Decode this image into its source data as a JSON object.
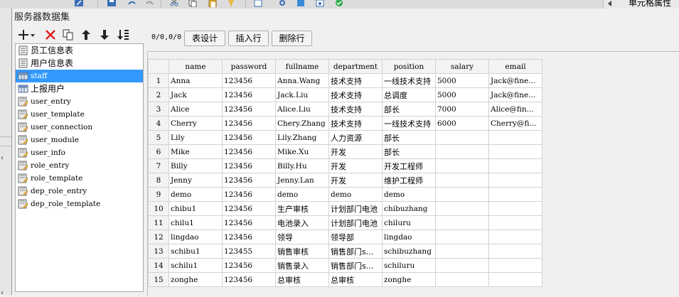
{
  "background": {
    "right_panel_label": "单元格属性"
  },
  "dialog": {
    "title": "服务器数据集"
  },
  "left_toolbar": {
    "add_icon": "plus-dropdown-icon",
    "delete_icon": "red-x-icon",
    "copy_icon": "copy-icon",
    "up_icon": "arrow-up-icon",
    "down_icon": "arrow-down-icon",
    "sort_icon": "sort-icon"
  },
  "tree": {
    "items": [
      {
        "label": "员工信息表",
        "icon": "table-doc-icon",
        "selected": false
      },
      {
        "label": "用户信息表",
        "icon": "table-doc-icon",
        "selected": false
      },
      {
        "label": "staff",
        "icon": "db-table-icon",
        "selected": true
      },
      {
        "label": "上报用户",
        "icon": "db-table-icon",
        "selected": false
      },
      {
        "label": "user_entry",
        "icon": "class-icon",
        "selected": false
      },
      {
        "label": "user_template",
        "icon": "class-icon",
        "selected": false
      },
      {
        "label": "user_connection",
        "icon": "class-icon",
        "selected": false
      },
      {
        "label": "user_module",
        "icon": "class-icon",
        "selected": false
      },
      {
        "label": "user_info",
        "icon": "class-icon",
        "selected": false
      },
      {
        "label": "role_entry",
        "icon": "class-icon",
        "selected": false
      },
      {
        "label": "role_template",
        "icon": "class-icon",
        "selected": false
      },
      {
        "label": "dep_role_entry",
        "icon": "class-icon",
        "selected": false
      },
      {
        "label": "dep_role_template",
        "icon": "class-icon",
        "selected": false
      }
    ]
  },
  "right_toolbar": {
    "coord": "0/0,0/0",
    "design_label": "表设计",
    "insert_label": "插入行",
    "delete_label": "删除行"
  },
  "grid": {
    "columns": [
      "name",
      "password",
      "fullname",
      "department",
      "position",
      "salary",
      "email"
    ],
    "rows": [
      [
        "1",
        "Anna",
        "123456",
        "Anna.Wang",
        "技术支持",
        "一线技术支持",
        "5000",
        "Jack@fine..."
      ],
      [
        "2",
        "Jack",
        "123456",
        "Jack.Liu",
        "技术支持",
        "总调度",
        "5000",
        "Jack@fine..."
      ],
      [
        "3",
        "Alice",
        "123456",
        "Alice.Liu",
        "技术支持",
        "部长",
        "7000",
        "Alice@fin..."
      ],
      [
        "4",
        "Cherry",
        "123456",
        "Chery.Zhang",
        "技术支持",
        "一线技术支持",
        "6000",
        "Cherry@fi..."
      ],
      [
        "5",
        "Lily",
        "123456",
        "Lily.Zhang",
        "人力资源",
        "部长",
        "",
        ""
      ],
      [
        "6",
        "Mike",
        "123456",
        "Mike.Xu",
        "开发",
        "部长",
        "",
        ""
      ],
      [
        "7",
        "Billy",
        "123456",
        "Billy.Hu",
        "开发",
        "开发工程师",
        "",
        ""
      ],
      [
        "8",
        "Jenny",
        "123456",
        "Jenny.Lan",
        "开发",
        "维护工程师",
        "",
        ""
      ],
      [
        "9",
        "demo",
        "123456",
        "demo",
        "demo",
        "demo",
        "",
        ""
      ],
      [
        "10",
        "chibu1",
        "123456",
        "生产审核",
        "计划部门电池",
        "chibuzhang",
        "",
        ""
      ],
      [
        "11",
        "chilu1",
        "123456",
        "电池录入",
        "计划部门电池",
        "chiluru",
        "",
        ""
      ],
      [
        "12",
        "lingdao",
        "123456",
        "领导",
        "领导部",
        "lingdao",
        "",
        ""
      ],
      [
        "13",
        "schibu1",
        "123455",
        "销售审核",
        "销售部门s...",
        "schibuzhang",
        "",
        ""
      ],
      [
        "14",
        "schilu1",
        "123456",
        "销售录入",
        "销售部门s...",
        "schiluru",
        "",
        ""
      ],
      [
        "15",
        "zonghe",
        "123456",
        "总审核",
        "总审核",
        "zonghe",
        "",
        ""
      ]
    ]
  }
}
